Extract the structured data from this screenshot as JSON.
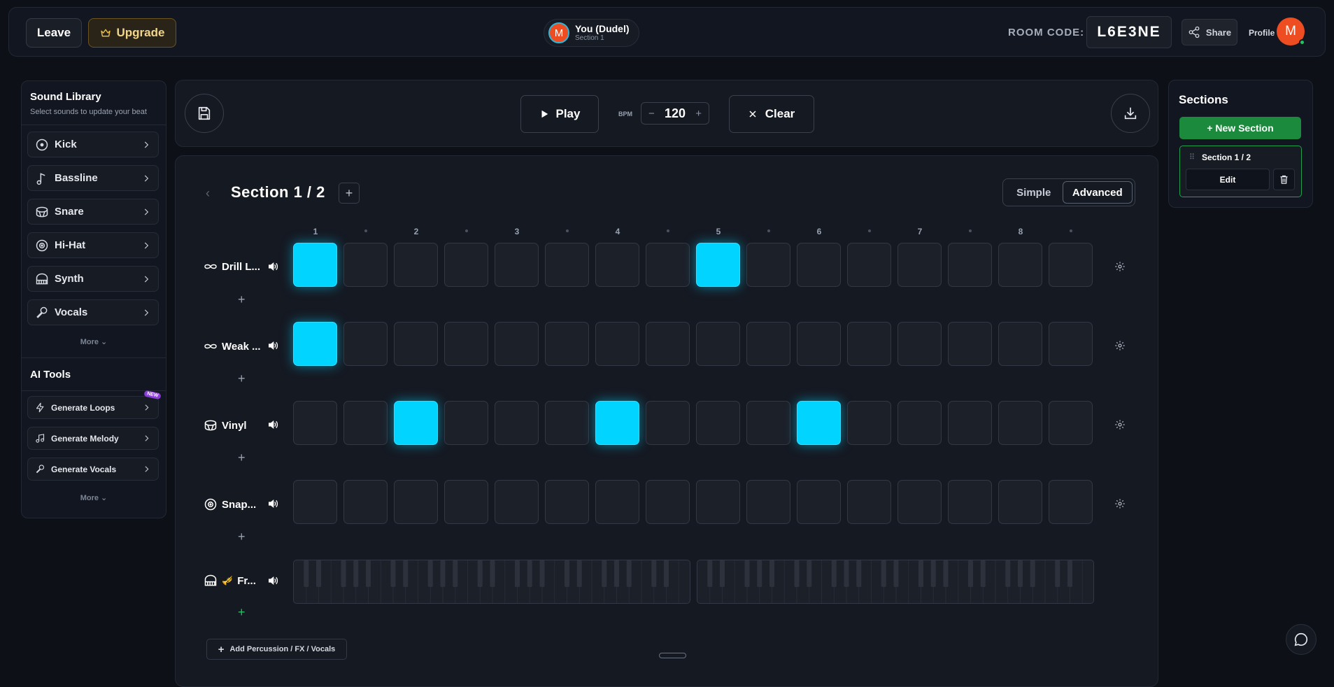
{
  "header": {
    "leave_label": "Leave",
    "upgrade_label": "Upgrade",
    "user_initial": "M",
    "user_name": "You (Dudel)",
    "user_section": "Section 1",
    "room_code_label": "ROOM CODE:",
    "room_code": "L6E3NE",
    "share_label": "Share",
    "profile_label": "Profile",
    "profile_initial": "M"
  },
  "sound_library": {
    "title": "Sound Library",
    "subtitle": "Select sounds to update your beat",
    "items": [
      {
        "label": "Kick",
        "icon": "kick-icon"
      },
      {
        "label": "Bassline",
        "icon": "music-note-icon"
      },
      {
        "label": "Snare",
        "icon": "drum-icon"
      },
      {
        "label": "Hi-Hat",
        "icon": "hihat-icon"
      },
      {
        "label": "Synth",
        "icon": "piano-icon"
      },
      {
        "label": "Vocals",
        "icon": "microphone-icon"
      }
    ],
    "more_label": "More"
  },
  "ai_tools": {
    "title": "AI Tools",
    "new_badge": "NEW",
    "items": [
      {
        "label": "Generate Loops",
        "icon": "lightning-icon"
      },
      {
        "label": "Generate Melody",
        "icon": "music-note-icon"
      },
      {
        "label": "Generate Vocals",
        "icon": "microphone-icon"
      }
    ],
    "more_label": "More"
  },
  "toolbar": {
    "play_label": "Play",
    "bpm_label": "BPM",
    "bpm_value": "120",
    "bpm_minus": "−",
    "bpm_plus": "+",
    "clear_label": "Clear"
  },
  "sequencer": {
    "section_title": "Section 1 / 2",
    "mode_simple": "Simple",
    "mode_advanced": "Advanced",
    "beat_numbers": [
      "1",
      "2",
      "3",
      "4",
      "5",
      "6",
      "7",
      "8"
    ],
    "tracks": [
      {
        "label": "Drill L...",
        "icon": "infinity-icon",
        "steps": [
          1,
          0,
          0,
          0,
          0,
          0,
          0,
          0,
          1,
          0,
          0,
          0,
          0,
          0,
          0,
          0
        ]
      },
      {
        "label": "Weak ...",
        "icon": "infinity-icon",
        "steps": [
          1,
          0,
          0,
          0,
          0,
          0,
          0,
          0,
          0,
          0,
          0,
          0,
          0,
          0,
          0,
          0
        ]
      },
      {
        "label": "Vinyl",
        "icon": "drum-icon",
        "steps": [
          0,
          0,
          1,
          0,
          0,
          0,
          1,
          0,
          0,
          0,
          1,
          0,
          0,
          0,
          0,
          0
        ]
      },
      {
        "label": "Snap...",
        "icon": "hihat-icon",
        "steps": [
          0,
          0,
          0,
          0,
          0,
          0,
          0,
          0,
          0,
          0,
          0,
          0,
          0,
          0,
          0,
          0
        ]
      }
    ],
    "piano_track": {
      "label": "Fr...",
      "icon": "piano-icon",
      "emoji": "🎺"
    },
    "add_percussion_label": "Add Percussion / FX / Vocals",
    "active_color": "#00d4ff"
  },
  "sections_panel": {
    "title": "Sections",
    "new_section_label": "+ New Section",
    "card_name": "Section 1 / 2",
    "edit_label": "Edit"
  }
}
